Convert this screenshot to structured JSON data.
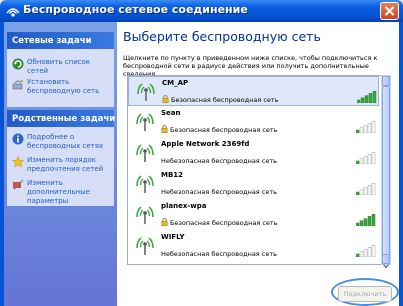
{
  "window": {
    "title": "Беспроводное сетевое соединение"
  },
  "sidebar": {
    "network_tasks": {
      "header": "Сетевые задачи",
      "items": [
        {
          "label": "Обновить список сетей",
          "icon": "refresh-icon"
        },
        {
          "label": "Установить беспроводную сеть",
          "icon": "wireless-setup-icon"
        }
      ]
    },
    "related_tasks": {
      "header": "Родственные задачи",
      "items": [
        {
          "label": "Подробнее о беспроводных сетях",
          "icon": "info-icon"
        },
        {
          "label": "Изменить порядок предпочтения сетей",
          "icon": "star-icon"
        },
        {
          "label": "Изменить дополнительные параметры",
          "icon": "settings-icon"
        }
      ]
    }
  },
  "main": {
    "title": "Выберите беспроводную сеть",
    "description": "Щелкните по пункту в приведенном ниже списке, чтобы подключиться к беспроводной сети в радиусе действия или получить дополнительные сведения.",
    "networks": [
      {
        "name": "CM_AP",
        "security": "Безопасная беспроводная сеть",
        "secured": true,
        "signal_bars": 5,
        "selected": true
      },
      {
        "name": "Sean",
        "security": "Безопасная беспроводная сеть",
        "secured": true,
        "signal_bars": 1,
        "selected": false
      },
      {
        "name": "Apple Network 2369fd",
        "security": "Небезопасная беспроводная сеть",
        "secured": false,
        "signal_bars": 1,
        "selected": false
      },
      {
        "name": "MB12",
        "security": "Небезопасная беспроводная сеть",
        "secured": false,
        "signal_bars": 1,
        "selected": false
      },
      {
        "name": "planex-wpa",
        "security": "Безопасная беспроводная сеть",
        "secured": true,
        "signal_bars": 5,
        "selected": false
      },
      {
        "name": "WIFLY",
        "security": "Небезопасная беспроводная сеть",
        "secured": false,
        "signal_bars": 1,
        "selected": false
      }
    ],
    "connect_button": "Подключить"
  },
  "colors": {
    "titlebar": "#0654d6",
    "sidebar": "#6375d6",
    "title_text": "#003399",
    "signal_active": "#3aa83a"
  }
}
